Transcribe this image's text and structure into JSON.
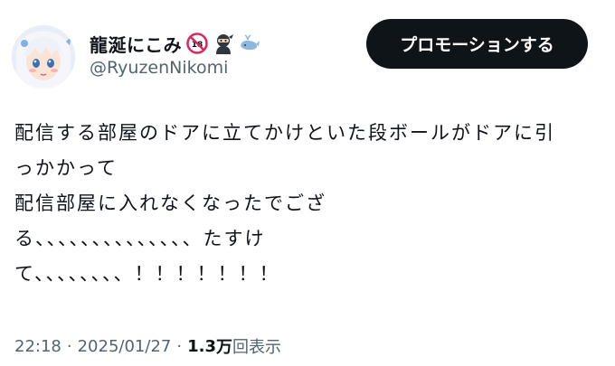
{
  "author": {
    "display_name": "龍涎にこみ",
    "handle": "@RyuzenNikomi",
    "badge_icons": [
      "no-under-18-icon",
      "ninja-icon",
      "whale-icon"
    ]
  },
  "promote_button": {
    "label": "プロモーションする"
  },
  "tweet": {
    "lines": [
      "配信する部屋のドアに立てかけといた段ボールがドアに引",
      "っかかって",
      "配信部屋に入れなくなったでござ",
      "る、、、、、、、、、、、、、、たすけ",
      "て、、、、、、、、！！！！！！！"
    ]
  },
  "meta": {
    "time": "22:18",
    "date": "2025/01/27",
    "view_count": "1.3",
    "view_unit": "万",
    "views_label": "回表示",
    "separator": "·"
  },
  "colors": {
    "text": "#0f1419",
    "secondary": "#536471",
    "button_bg": "#0f1419",
    "button_text": "#ffffff"
  }
}
